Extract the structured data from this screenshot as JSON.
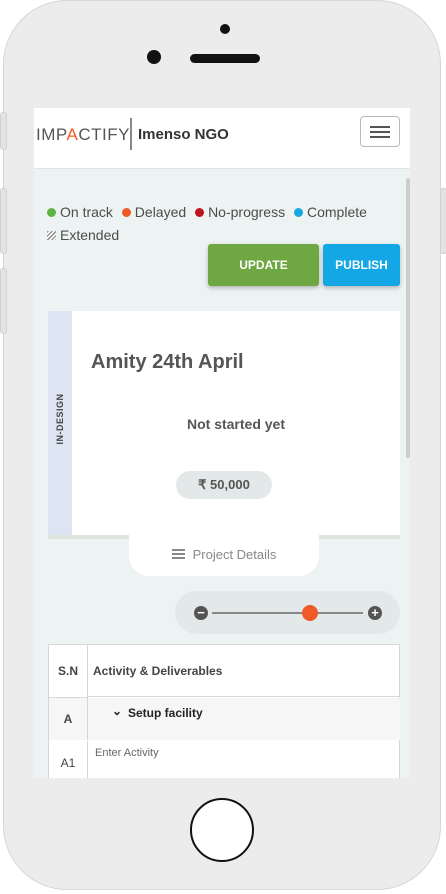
{
  "header": {
    "logo_left": "IMP",
    "logo_accent": "A",
    "logo_right": "CTIFY",
    "org_name": "Imenso NGO",
    "menu_icon": "hamburger-menu-icon"
  },
  "legend": [
    {
      "label": "On track",
      "color": "#5fb246"
    },
    {
      "label": "Delayed",
      "color": "#ef5a28"
    },
    {
      "label": "No-progress",
      "color": "#c0141b"
    },
    {
      "label": "Complete",
      "color": "#16a8e0"
    },
    {
      "label": "Extended",
      "pattern": "hatched"
    }
  ],
  "actions": {
    "update_label": "UPDATE",
    "publish_label": "PUBLISH"
  },
  "project": {
    "status_tag": "IN-DESIGN",
    "title": "Amity 24th April",
    "status": "Not started yet",
    "budget": "₹ 50,000",
    "details_label": "Project Details"
  },
  "zoom": {
    "minus": "−",
    "plus": "+",
    "level": 0.65
  },
  "table": {
    "headers": [
      "S.N",
      "Activity & Deliverables"
    ],
    "rows": [
      {
        "sn": "A",
        "activity": "Setup facility"
      },
      {
        "sn": "A1",
        "activity": "Enter Activity"
      }
    ]
  },
  "colors": {
    "accent": "#ef5a28",
    "update": "#6fa843",
    "publish": "#14a7e6"
  }
}
